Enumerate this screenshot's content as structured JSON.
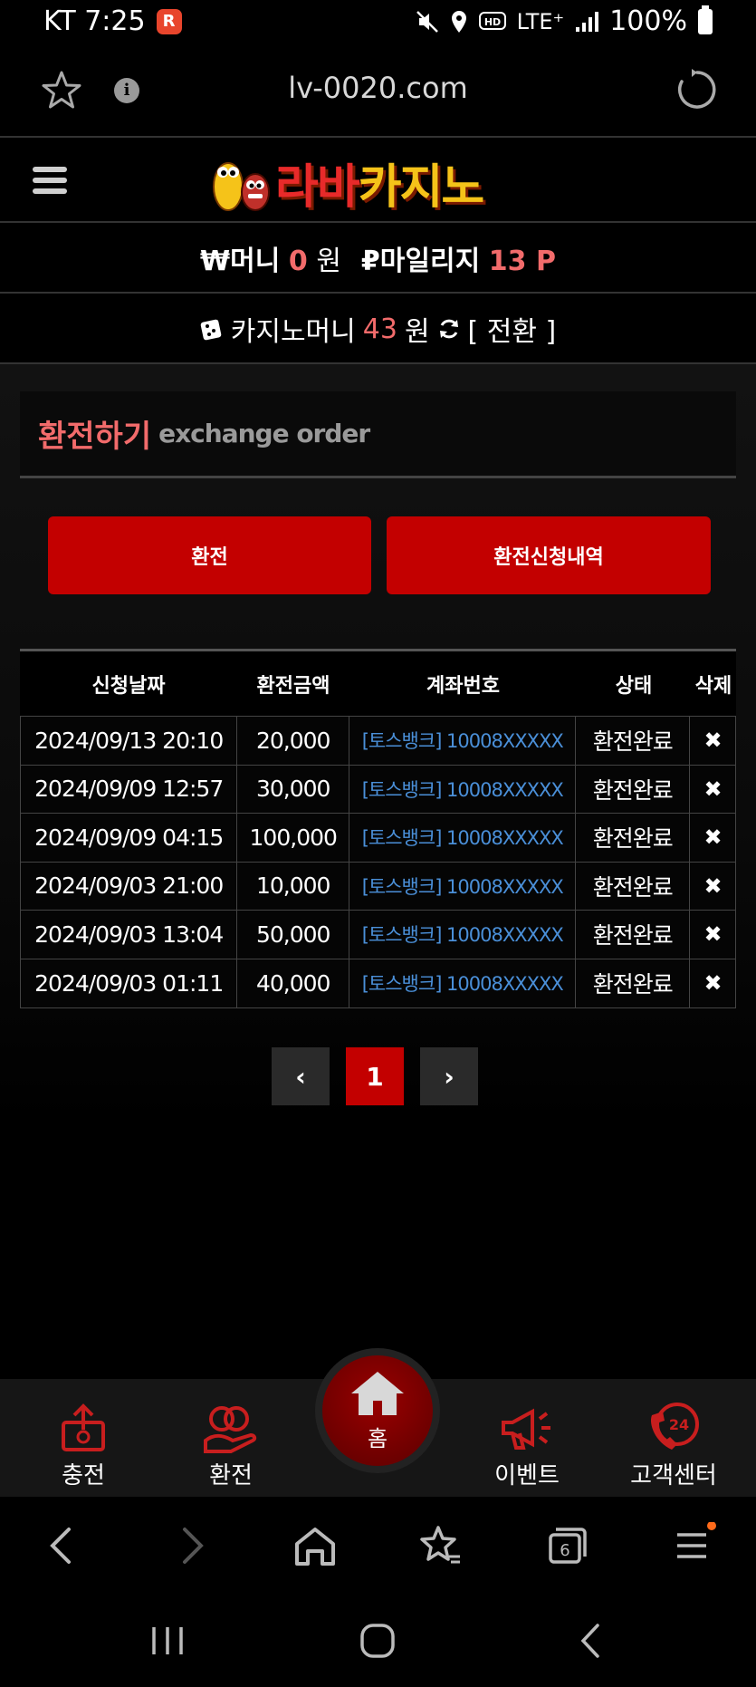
{
  "status_bar": {
    "carrier_time": "KT 7:25",
    "app_badge": "R",
    "network": "LTE⁺",
    "battery": "100%",
    "icons": [
      "mute-icon",
      "location-icon",
      "hd-icon",
      "signal-icon",
      "battery-icon"
    ]
  },
  "browser": {
    "url": "lv-0020.com",
    "info": "i"
  },
  "site": {
    "logo_text_a": "라바",
    "logo_text_b": "카지노"
  },
  "wallet": {
    "money_label": "₩머니",
    "money_value": "0",
    "money_unit": "원",
    "mileage_label": "₽마일리지",
    "mileage_value": "13 P",
    "casino_label": "카지노머니",
    "casino_value": "43",
    "casino_unit": "원",
    "convert_label": "[ 전환 ]"
  },
  "panel": {
    "title_ko": "환전하기",
    "title_en": "exchange order",
    "btn_exchange": "환전",
    "btn_history": "환전신청내역"
  },
  "table": {
    "headers": [
      "신청날짜",
      "환전금액",
      "계좌번호",
      "상태",
      "삭제"
    ],
    "rows": [
      {
        "date": "2024/09/13 20:10",
        "amount": "20,000",
        "account": "[토스뱅크] 10008XXXXX",
        "status": "환전완료",
        "delete": "✖"
      },
      {
        "date": "2024/09/09 12:57",
        "amount": "30,000",
        "account": "[토스뱅크] 10008XXXXX",
        "status": "환전완료",
        "delete": "✖"
      },
      {
        "date": "2024/09/09 04:15",
        "amount": "100,000",
        "account": "[토스뱅크] 10008XXXXX",
        "status": "환전완료",
        "delete": "✖"
      },
      {
        "date": "2024/09/03 21:00",
        "amount": "10,000",
        "account": "[토스뱅크] 10008XXXXX",
        "status": "환전완료",
        "delete": "✖"
      },
      {
        "date": "2024/09/03 13:04",
        "amount": "50,000",
        "account": "[토스뱅크] 10008XXXXX",
        "status": "환전완료",
        "delete": "✖"
      },
      {
        "date": "2024/09/03 01:11",
        "amount": "40,000",
        "account": "[토스뱅크] 10008XXXXX",
        "status": "환전완료",
        "delete": "✖"
      }
    ]
  },
  "pager": {
    "prev": "‹",
    "current": "1",
    "next": "›"
  },
  "site_nav": {
    "charge": "충전",
    "exchange": "환전",
    "home": "홈",
    "event": "이벤트",
    "support": "고객센터",
    "support_badge": "24"
  },
  "browser_toolbar": {
    "tabs_count": "6"
  },
  "colors": {
    "accent_red": "#c30000",
    "highlight": "#f26b6b",
    "link_blue": "#4a8fd8"
  }
}
